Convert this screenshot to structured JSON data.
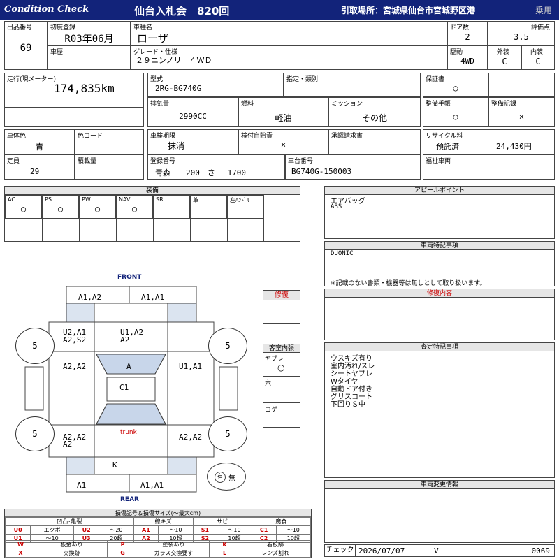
{
  "header": {
    "brand": "Condition Check",
    "auction": "仙台入札会　820回",
    "pickup": "引取場所：宮城県仙台市宮城野区港",
    "vehicle_type": "乗用"
  },
  "basic": {
    "lot_no_label": "出品番号",
    "lot_no": "69",
    "first_reg_label": "初度登録",
    "first_reg": "R03年06月",
    "car_name_label": "車種名",
    "car_name": "ローザ",
    "doors_label": "ドア数",
    "doors": "2",
    "score_label": "評価点",
    "score": "3.5",
    "history_label": "車歴",
    "grade_label": "グレード・仕様",
    "grade": "２９ニンノリ　４ＷＤ",
    "drive_label": "駆動",
    "drive": "4WD",
    "exterior_label": "外装",
    "exterior": "C",
    "interior_label": "内装",
    "interior": "C"
  },
  "specs": {
    "mileage_label": "走行(現メーター)",
    "mileage": "174,835km",
    "model_label": "型式",
    "model": "2RG-BG740G",
    "designation_label": "指定・類別",
    "warranty_label": "保証書",
    "warranty": "○",
    "displacement_label": "排気量",
    "displacement": "2990CC",
    "fuel_label": "燃料",
    "fuel": "軽油",
    "mission_label": "ミッション",
    "mission": "その他",
    "manual_label": "整備手帳",
    "manual": "○",
    "record_label": "整備記録",
    "record": "×",
    "color_label": "車体色",
    "color": "青",
    "color_code_label": "色コード",
    "inspection_label": "車検期限",
    "inspection": "抹消",
    "insurance_label": "検付自賠責",
    "insurance": "×",
    "approval_label": "承認請求書",
    "recycle_label": "リサイクル料",
    "recycle_status": "預託済",
    "recycle_fee": "24,430円",
    "capacity_label": "定員",
    "capacity": "29",
    "load_label": "積載量",
    "plate_label": "登録番号",
    "plate": "青森　　200　さ　 1700",
    "chassis_label": "車台番号",
    "chassis": "BG740G-150003",
    "welfare_label": "福祉車両"
  },
  "equipment": {
    "title": "装備",
    "items": [
      {
        "label": "AC",
        "value": "○"
      },
      {
        "label": "PS",
        "value": "○"
      },
      {
        "label": "PW",
        "value": "○"
      },
      {
        "label": "NAVI",
        "value": "○"
      },
      {
        "label": "SR",
        "value": ""
      },
      {
        "label": "革",
        "value": ""
      },
      {
        "label": "左ﾊﾝﾄﾞﾙ",
        "value": ""
      }
    ]
  },
  "appeal": {
    "title": "アピールポイント",
    "lines": [
      "エアバッグ",
      "ABS"
    ]
  },
  "special": {
    "title": "車両特記事項",
    "lines": [
      "DUONIC"
    ],
    "note": "※記載のない書類・機器等は無しとして取り扱います。"
  },
  "repair": {
    "title": "修復内容"
  },
  "assessment": {
    "title": "査定特記事項",
    "lines": [
      "ウスキズ有り",
      "室内汚れ/スレ",
      "シートヤブレ",
      "Wタイヤ",
      "自動ドア付き",
      "グリスコート",
      "下回りＳ中"
    ]
  },
  "change": {
    "title": "車両変更情報"
  },
  "check": {
    "label": "チェック",
    "date": "2026/07/07",
    "mark": "V",
    "number": "0069"
  },
  "diagram": {
    "front": "FRONT",
    "rear": "REAR",
    "trunk": "trunk",
    "repair_label": "修復",
    "cabin_title": "客室内張",
    "cabin_tear": "ヤブレ",
    "cabin_tear_mark": "○",
    "cabin_hole": "穴",
    "cabin_burn": "コゲ",
    "spare_yes": "有",
    "spare_no": "無",
    "tires": [
      "5",
      "5",
      "5",
      "5"
    ],
    "damage": {
      "front_left": "A1,A2",
      "front_right": "A1,A1",
      "fender_l_1": "U2,A1",
      "fender_l_2": "A2,S2",
      "hood_1": "U1,A2",
      "hood_2": "A2",
      "door_l": "A2,A2",
      "windshield": "A",
      "door_r": "U1,A1",
      "roof": "C1",
      "rear_l_1": "A2,A2",
      "rear_l_2": "A2",
      "rear_r": "A2,A2",
      "rear_k": "K",
      "bumper_l": "A1",
      "bumper_r": "A1,A1"
    }
  },
  "legend": {
    "title": "損傷記号＆損傷サイズ(～最大cm)",
    "headers": [
      "凹凸･亀裂",
      "線キズ",
      "サビ",
      "腐食"
    ],
    "row1": [
      "U0",
      "エクボ",
      "U2",
      "～20",
      "A1",
      "～10",
      "S1",
      "～10",
      "C1",
      "～10"
    ],
    "row2": [
      "U1",
      "～10",
      "U3",
      "20超",
      "A2",
      "10超",
      "S2",
      "10超",
      "C2",
      "10超"
    ],
    "row3": [
      "W",
      "板金あり",
      "P",
      "塗装あり",
      "K",
      "看板跡"
    ],
    "row4": [
      "X",
      "交換跡",
      "G",
      "ガラス交換要す",
      "L",
      "レンズ割れ"
    ]
  }
}
